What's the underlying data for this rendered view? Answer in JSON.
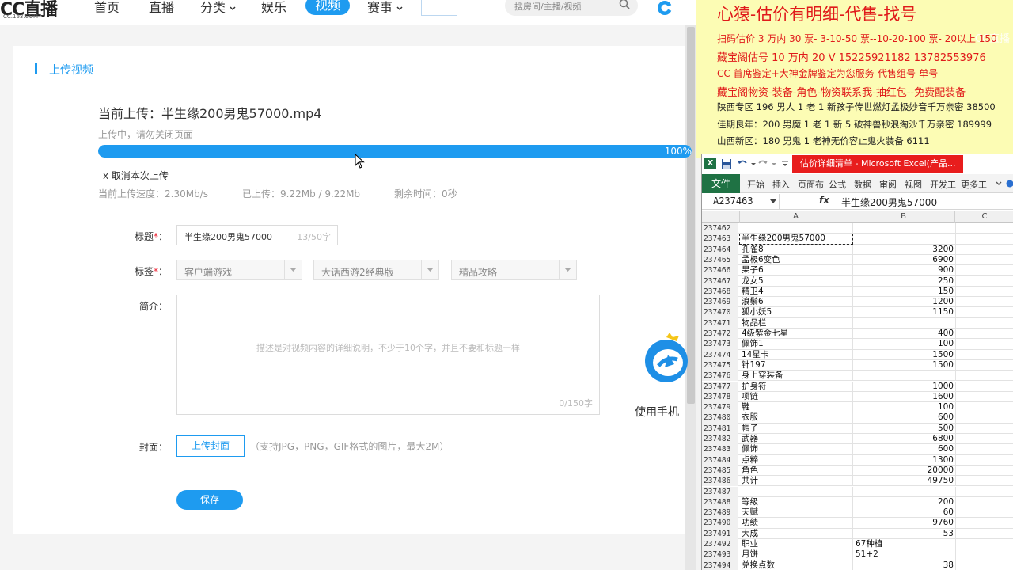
{
  "cc_nav": {
    "logo": "CC直播",
    "logo_sub": "CC.163.COM",
    "items": [
      "首页",
      "直播",
      "分类",
      "娱乐",
      "视频",
      "赛事"
    ],
    "active_item": "视频",
    "search_placeholder": "搜房间/主播/视频"
  },
  "upload": {
    "section_title": "上传视频",
    "current_upload": "当前上传：半生缘200男鬼57000.mp4",
    "status": "上传中，请勿关闭页面",
    "progress_percent": 100,
    "progress_label": "100%",
    "cancel_label": "x 取消本次上传",
    "speed": "当前上传速度：2.30Mb/s",
    "uploaded": "已上传：9.22Mb / 9.22Mb",
    "remaining": "剩余时间：0秒"
  },
  "form": {
    "title_label": "标题",
    "title_value": "半生缘200男鬼57000",
    "title_count": "13/50字",
    "tags_label": "标签",
    "tags": [
      "客户端游戏",
      "大话西游2经典版",
      "精品攻略"
    ],
    "intro_label": "简介：",
    "intro_placeholder": "描述是对视频内容的详细说明，不少于10个字，并且不要和标题一样",
    "intro_count": "0/150字",
    "cover_label": "封面：",
    "cover_button": "上传封面",
    "cover_hint": "（支持JPG，PNG，GIF格式的图片，最大2M）",
    "save_button": "保存"
  },
  "side_promo": {
    "mobile_label": "使用手机"
  },
  "overlay": {
    "title": "心猿-估价有明细-代售-找号",
    "watermark": "CC直播",
    "lines": [
      "扫码估价 3 万内 30 票- 3-10-50 票--10-20-100 票- 20以上 150",
      "藏宝阁估号 10 万内 20 V 15225921182   13782553976",
      "CC 首席鉴定+大神金牌鉴定为您服务-代售组号-单号",
      "藏宝阁物资-装备-角色-物资联系我-抽红包--免费配装备",
      "陕西专区 196 男人 1 老 1 新孩子传世燃灯孟极妙音千万亲密 38500",
      "佳期良年：200 男魔 1 老 1 新 5 破神兽秒浪淘沙千万亲密 189999",
      "山西新区：180 男鬼 1 老神无价容止鬼火装备 6111"
    ]
  },
  "excel": {
    "title": "估价详细清单 - Microsoft Excel(产品...",
    "ribbon_tabs": [
      "文件",
      "开始",
      "插入",
      "页面布",
      "公式",
      "数据",
      "审阅",
      "视图",
      "开发工",
      "更多工"
    ],
    "name_box": "A237463",
    "fx": "fx",
    "formula": "半生缘200男鬼57000",
    "columns": [
      "A",
      "B",
      "C"
    ],
    "rows": [
      {
        "n": "237462",
        "a": "",
        "b": ""
      },
      {
        "n": "237463",
        "a": "半生缘200男鬼57000",
        "b": ""
      },
      {
        "n": "237464",
        "a": "孔雀8",
        "b": "3200"
      },
      {
        "n": "237465",
        "a": "孟极6变色",
        "b": "6900"
      },
      {
        "n": "237466",
        "a": "果子6",
        "b": "900"
      },
      {
        "n": "237467",
        "a": "龙女5",
        "b": "250"
      },
      {
        "n": "237468",
        "a": "精卫4",
        "b": "150"
      },
      {
        "n": "237469",
        "a": "浪鬃6",
        "b": "1200"
      },
      {
        "n": "237470",
        "a": "狐小妖5",
        "b": "1150"
      },
      {
        "n": "237471",
        "a": "物品栏",
        "b": ""
      },
      {
        "n": "237472",
        "a": "4级紫金七星",
        "b": "400"
      },
      {
        "n": "237473",
        "a": "佩饰1",
        "b": "100"
      },
      {
        "n": "237474",
        "a": "14星卡",
        "b": "1500"
      },
      {
        "n": "237475",
        "a": "针197",
        "b": "1500"
      },
      {
        "n": "237476",
        "a": "身上穿装备",
        "b": ""
      },
      {
        "n": "237477",
        "a": "护身符",
        "b": "1000"
      },
      {
        "n": "237478",
        "a": "项链",
        "b": "1600"
      },
      {
        "n": "237479",
        "a": "鞋",
        "b": "100"
      },
      {
        "n": "237480",
        "a": "衣服",
        "b": "600"
      },
      {
        "n": "237481",
        "a": "帽子",
        "b": "500"
      },
      {
        "n": "237482",
        "a": "武器",
        "b": "6800"
      },
      {
        "n": "237483",
        "a": "佩饰",
        "b": "600"
      },
      {
        "n": "237484",
        "a": "点粹",
        "b": "1300"
      },
      {
        "n": "237485",
        "a": "角色",
        "b": "20000"
      },
      {
        "n": "237486",
        "a": "共计",
        "b": "49750"
      },
      {
        "n": "237487",
        "a": "",
        "b": ""
      },
      {
        "n": "237488",
        "a": "等级",
        "b": "200"
      },
      {
        "n": "237489",
        "a": "天赋",
        "b": "60"
      },
      {
        "n": "237490",
        "a": "功绩",
        "b": "9760"
      },
      {
        "n": "237491",
        "a": "大成",
        "b": "53"
      },
      {
        "n": "237492",
        "a": "职业",
        "b": "67种植",
        "b_left": true
      },
      {
        "n": "237493",
        "a": "月饼",
        "b": "51+2",
        "b_left": true
      },
      {
        "n": "237494",
        "a": "兑换点数",
        "b": "38"
      }
    ]
  }
}
